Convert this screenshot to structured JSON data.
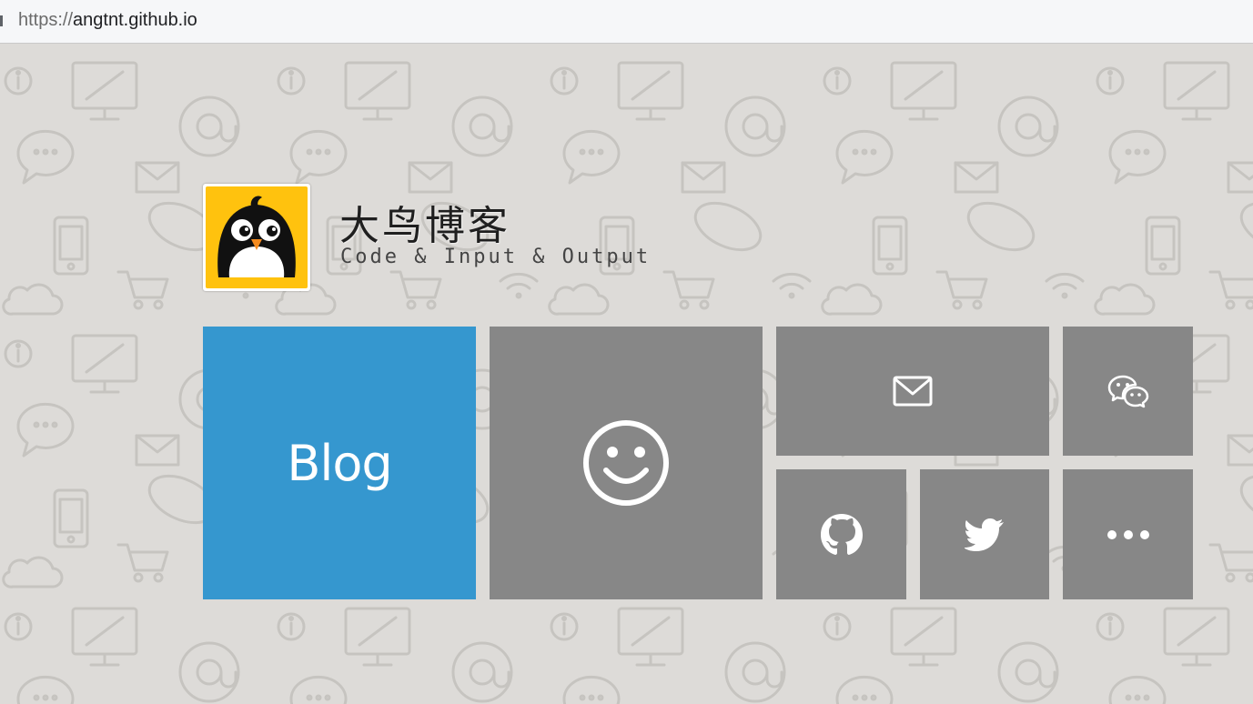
{
  "browser": {
    "url_scheme": "https://",
    "url_host": "angtnt.github.io"
  },
  "site": {
    "title": "大鸟博客",
    "subtitle": "Code & Input & Output",
    "avatar_icon": "penguin-bird-avatar",
    "avatar_color": "#ffc20e"
  },
  "tiles": {
    "blog": {
      "label": "Blog",
      "color": "#3597cf"
    },
    "about": {
      "icon": "smiley-icon",
      "color": "#878787"
    },
    "email": {
      "icon": "mail-icon"
    },
    "wechat": {
      "icon": "wechat-icon"
    },
    "github": {
      "icon": "github-icon"
    },
    "twitter": {
      "icon": "twitter-icon"
    },
    "more": {
      "icon": "more-icon"
    }
  }
}
